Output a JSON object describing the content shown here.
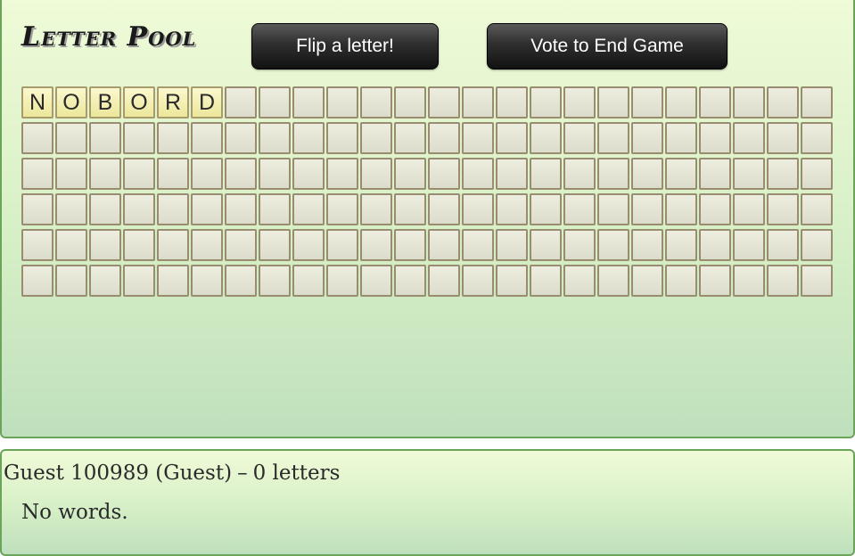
{
  "pool": {
    "title": "Letter Pool",
    "flip_label": "Flip a letter!",
    "vote_label": "Vote to End Game",
    "tile_count": 144,
    "tiles_per_row": 24,
    "flipped_letters": [
      "N",
      "O",
      "B",
      "O",
      "R",
      "D"
    ]
  },
  "player": {
    "name": "Guest 100989 (Guest)",
    "separator": "–",
    "letters": "0 letters",
    "words": "No words."
  }
}
